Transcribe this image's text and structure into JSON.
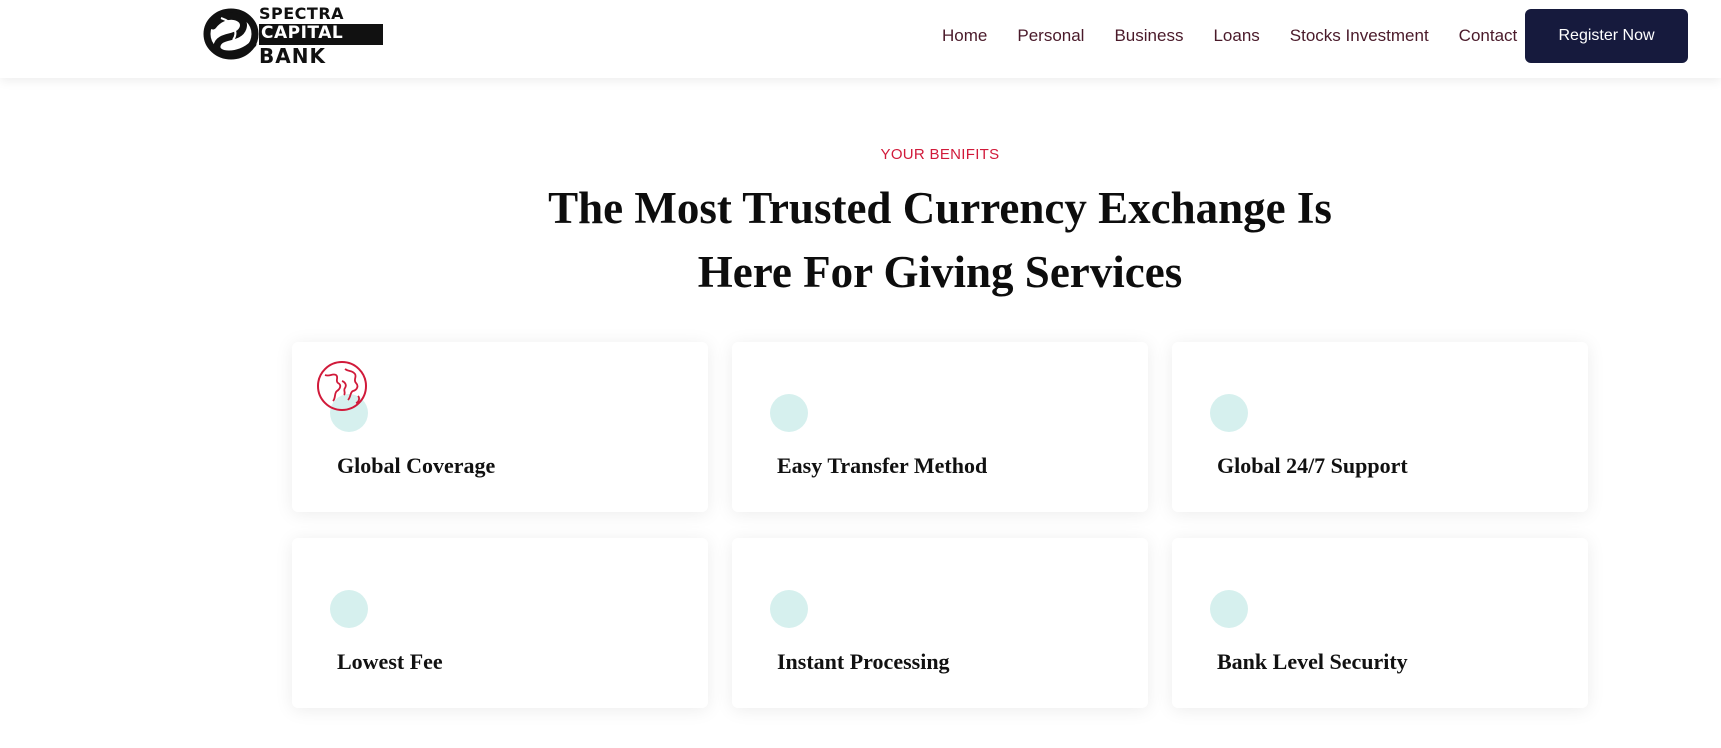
{
  "brand": {
    "logo_line1": "SPECTRA",
    "logo_line2": "CAPITAL",
    "logo_line3": "BANK"
  },
  "nav": {
    "items": [
      {
        "label": "Home"
      },
      {
        "label": "Personal"
      },
      {
        "label": "Business"
      },
      {
        "label": "Loans"
      },
      {
        "label": "Stocks Investment"
      },
      {
        "label": "Contact"
      }
    ],
    "cta_label": "Register Now"
  },
  "section": {
    "eyebrow": "YOUR BENIFITS",
    "title_line1": "The Most Trusted Currency Exchange Is",
    "title_line2": "Here For Giving Services"
  },
  "features": [
    {
      "title": "Global Coverage",
      "icon": "globe-icon"
    },
    {
      "title": "Easy Transfer Method",
      "icon": ""
    },
    {
      "title": "Global 24/7 Support",
      "icon": ""
    },
    {
      "title": "Lowest Fee",
      "icon": ""
    },
    {
      "title": "Instant Processing",
      "icon": ""
    },
    {
      "title": "Bank Level Security",
      "icon": ""
    }
  ],
  "colors": {
    "accent_red": "#d11a3a",
    "cta_navy": "#161a3d",
    "icon_bg_mint": "#d6f0ee",
    "nav_text": "#4a1a2a"
  }
}
